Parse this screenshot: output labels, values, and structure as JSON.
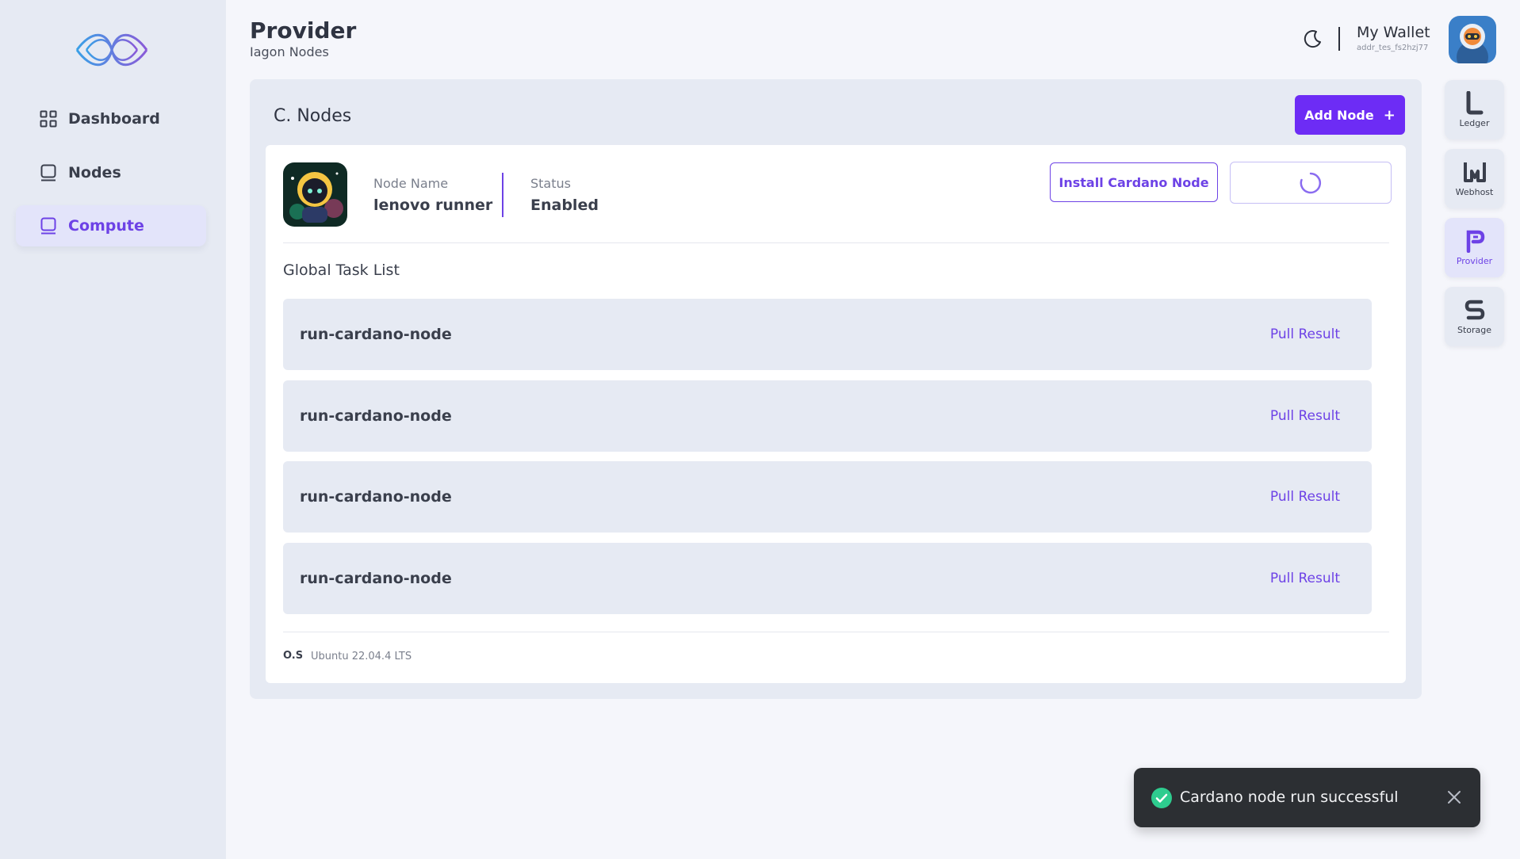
{
  "header": {
    "title": "Provider",
    "subtitle": "Iagon Nodes",
    "wallet_name": "My Wallet",
    "wallet_address": "addr_tes_fs2hzj77"
  },
  "sidebar": {
    "items": [
      {
        "label": "Dashboard",
        "icon": "dashboard-grid-icon",
        "active": false
      },
      {
        "label": "Nodes",
        "icon": "node-icon",
        "active": false
      },
      {
        "label": "Compute",
        "icon": "compute-icon",
        "active": true
      }
    ]
  },
  "rail": {
    "items": [
      {
        "label": "Ledger",
        "icon": "ledger-icon",
        "active": false
      },
      {
        "label": "Webhost",
        "icon": "webhost-icon",
        "active": false
      },
      {
        "label": "Provider",
        "icon": "provider-icon",
        "active": true
      },
      {
        "label": "Storage",
        "icon": "storage-icon",
        "active": false
      }
    ]
  },
  "panel": {
    "title": "C. Nodes",
    "add_button": "Add Node",
    "add_button_icon": "+"
  },
  "node": {
    "name_label": "Node Name",
    "name_value": "lenovo runner",
    "status_label": "Status",
    "status_value": "Enabled",
    "install_button": "Install Cardano Node"
  },
  "tasks": {
    "title": "Global Task List",
    "rows": [
      {
        "name": "run-cardano-node",
        "action": "Pull Result"
      },
      {
        "name": "run-cardano-node",
        "action": "Pull Result"
      },
      {
        "name": "run-cardano-node",
        "action": "Pull Result"
      },
      {
        "name": "run-cardano-node",
        "action": "Pull Result"
      }
    ]
  },
  "os": {
    "label": "O.S",
    "value": "Ubuntu 22.04.4 LTS"
  },
  "toast": {
    "message": "Cardano node run successful"
  },
  "colors": {
    "accent": "#6d2cf5",
    "active_text": "#6d42e6",
    "sidebar_bg": "#e6eaf3",
    "toast_bg": "#2c2f33",
    "success": "#2ecc8f"
  }
}
